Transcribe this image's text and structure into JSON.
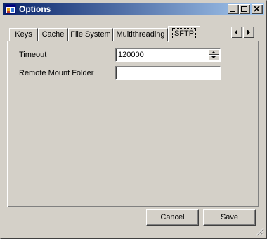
{
  "window": {
    "title": "Options",
    "icon": "app-window-icon"
  },
  "title_buttons": {
    "minimize": "minimize-icon",
    "maximize": "maximize-icon",
    "close": "close-icon"
  },
  "tabs": [
    {
      "label": "Keys",
      "selected": false
    },
    {
      "label": "Cache",
      "selected": false
    },
    {
      "label": "File System",
      "selected": false
    },
    {
      "label": "Multithreading",
      "selected": false
    },
    {
      "label": "SFTP",
      "selected": true
    }
  ],
  "tab_scroll": {
    "left": "arrow-left-icon",
    "right": "arrow-right-icon"
  },
  "sftp": {
    "timeout_label": "Timeout",
    "timeout_value": "120000",
    "remote_mount_label": "Remote Mount Folder",
    "remote_mount_value": "."
  },
  "buttons": {
    "cancel": "Cancel",
    "save": "Save"
  },
  "colors": {
    "face": "#d4d0c8",
    "title_start": "#0a246a",
    "title_end": "#a6caf0"
  }
}
